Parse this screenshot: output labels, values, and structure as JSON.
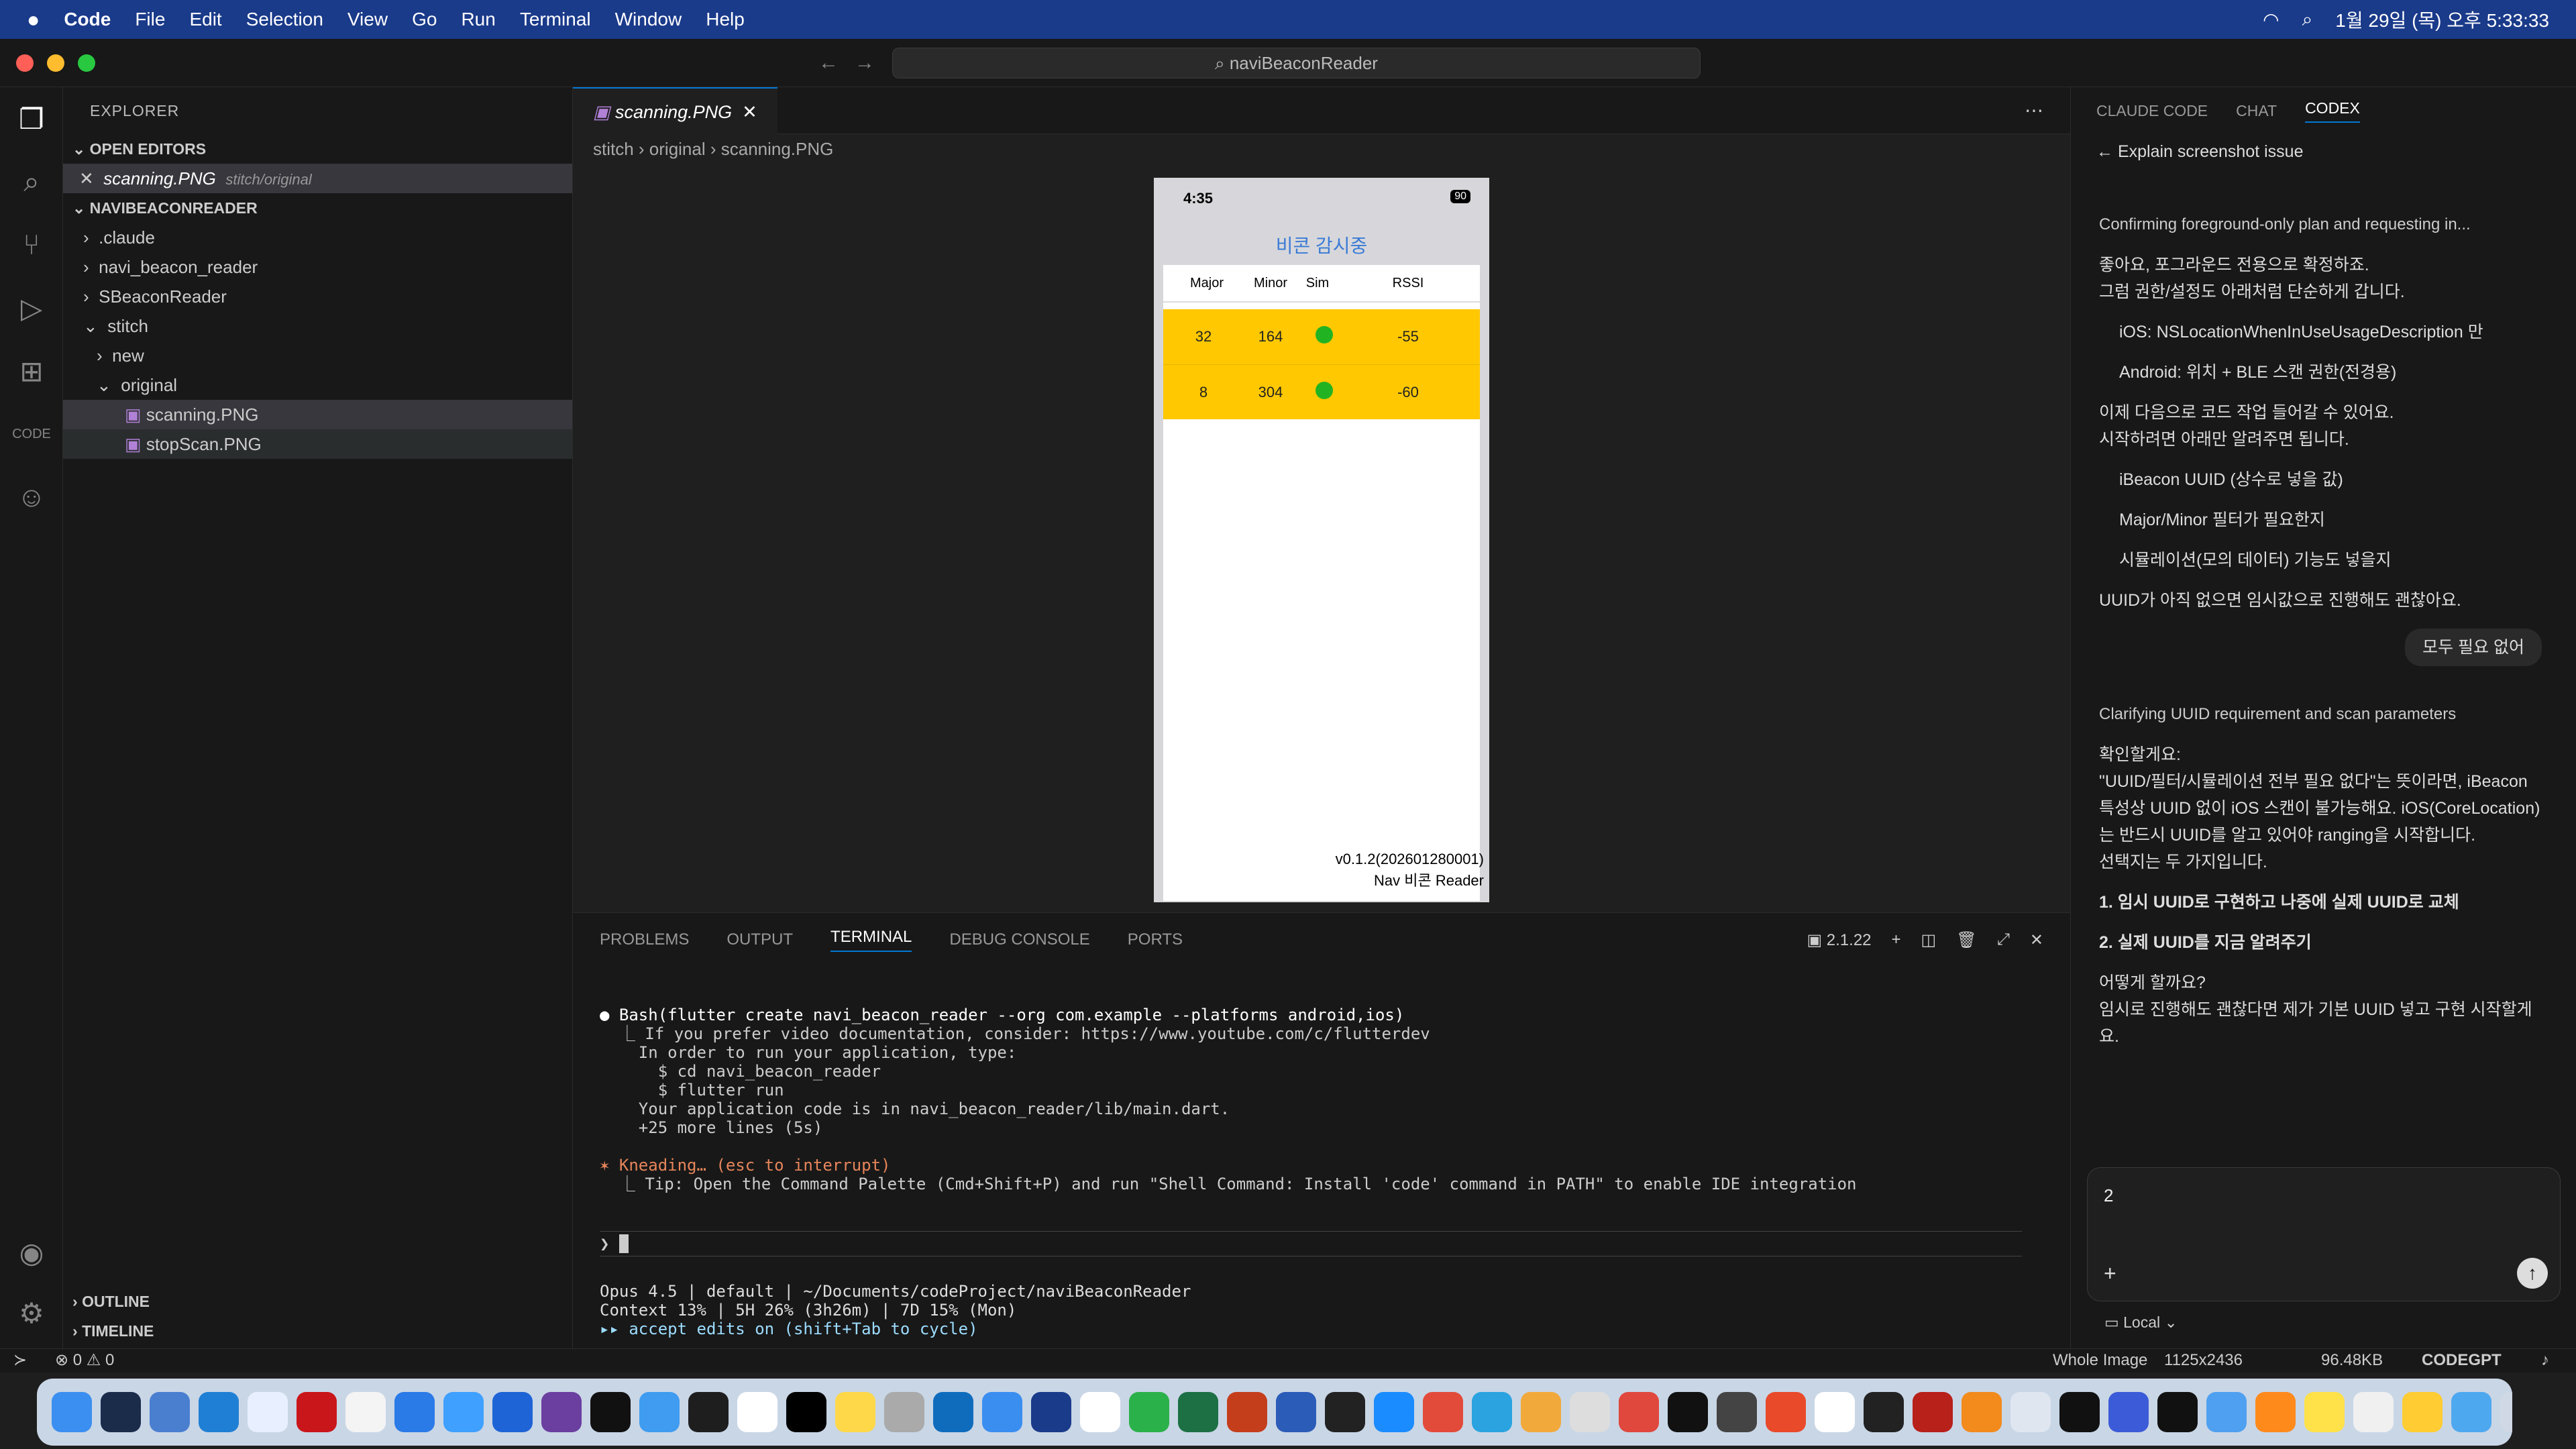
{
  "menubar": {
    "app": "Code",
    "items": [
      "File",
      "Edit",
      "Selection",
      "View",
      "Go",
      "Run",
      "Terminal",
      "Window",
      "Help"
    ],
    "clock": "1월 29일 (목) 오후 5:33:33"
  },
  "window": {
    "search": "naviBeaconReader"
  },
  "explorer": {
    "title": "EXPLORER",
    "open_editors": "OPEN EDITORS",
    "open_file": "scanning.PNG",
    "open_path": "stitch/original",
    "project": "NAVIBEACONREADER",
    "tree": [
      ".claude",
      "navi_beacon_reader",
      "SBeaconReader",
      "stitch",
      "new",
      "original",
      "scanning.PNG",
      "stopScan.PNG"
    ],
    "outline": "OUTLINE",
    "timeline": "TIMELINE"
  },
  "editor": {
    "tab": "scanning.PNG",
    "crumbs": [
      "stitch",
      "original",
      "scanning.PNG"
    ]
  },
  "phone": {
    "time": "4:35",
    "battery": "90",
    "title": "비콘 감시중",
    "headers": [
      "Major",
      "Minor",
      "Sim",
      "RSSI"
    ],
    "rows": [
      [
        "32",
        "164",
        "-55"
      ],
      [
        "8",
        "304",
        "-60"
      ]
    ],
    "version": "v0.1.2(202601280001)",
    "app_name": "Nav 비콘 Reader"
  },
  "panel": {
    "tabs": [
      "PROBLEMS",
      "OUTPUT",
      "TERMINAL",
      "DEBUG CONSOLE",
      "PORTS"
    ],
    "active_tab": "TERMINAL",
    "shell_version": "2.1.22",
    "lines": [
      "● Bash(flutter create navi_beacon_reader --org com.example --platforms android,ios)",
      "  ⎿ If you prefer video documentation, consider: https://www.youtube.com/c/flutterdev",
      "    In order to run your application, type:",
      "      $ cd navi_beacon_reader",
      "      $ flutter run",
      "    Your application code is in navi_beacon_reader/lib/main.dart.",
      "    +25 more lines (5s)",
      "",
      "✶ Kneading… (esc to interrupt)",
      "  ⎿ Tip: Open the Command Palette (Cmd+Shift+P) and run \"Shell Command: Install 'code' command in PATH\" to enable IDE integration"
    ],
    "prompt": "❯",
    "status1": "Opus 4.5 | default | ~/Documents/codeProject/naviBeaconReader",
    "status2": "Context 13% | 5H 26% (3h26m) | 7D 15% (Mon)",
    "status3": "▸▸ accept edits on (shift+Tab to cycle)"
  },
  "codex": {
    "tabs": [
      "CLAUDE CODE",
      "CHAT",
      "CODEX"
    ],
    "thread_title": "Explain screenshot issue",
    "heading1": "Confirming foreground-only plan and requesting in...",
    "p1": "좋아요, 포그라운드 전용으로 확정하죠.",
    "p2": "그럼 권한/설정도 아래처럼 단순하게 갑니다.",
    "b1": "iOS: NSLocationWhenInUseUsageDescription 만",
    "b2": "Android: 위치 + BLE 스캔 권한(전경용)",
    "p3": "이제 다음으로 코드 작업 들어갈 수 있어요.",
    "p4": "시작하려면 아래만 알려주면 됩니다.",
    "b3": "iBeacon UUID (상수로 넣을 값)",
    "b4": "Major/Minor 필터가 필요한지",
    "b5": "시뮬레이션(모의 데이터) 기능도 넣을지",
    "p5": "UUID가 아직 없으면 임시값으로 진행해도 괜찮아요.",
    "user_msg": "모두 필요 없어",
    "heading2": "Clarifying UUID requirement and scan parameters",
    "p6": "확인할게요:",
    "p7": "\"UUID/필터/시뮬레이션 전부 필요 없다\"는 뜻이라면, iBeacon 특성상 UUID 없이 iOS 스캔이 불가능해요. iOS(CoreLocation)는 반드시 UUID를 알고 있어야 ranging을 시작합니다.",
    "p8": "선택지는 두 가지입니다.",
    "o1": "1. 임시 UUID로 구현하고 나중에 실제 UUID로 교체",
    "o2": "2. 실제 UUID를 지금 알려주기",
    "p9": "어떻게 할까요?",
    "p10": "임시로 진행해도 괜찮다면 제가 기본 UUID 넣고 구현 시작할게요.",
    "input": "2",
    "local": "Local"
  },
  "statusbar": {
    "problems": "⊗ 0 ⚠ 0",
    "right1": "Whole Image",
    "right2": "1125x2436",
    "right3": "96.48KB",
    "right4": "CODEGPT"
  },
  "colors": {
    "accent": "#0078d4",
    "row_yellow": "#ffc800",
    "title_blue": "#3a7bd5",
    "menubar": "#1a3a8a"
  }
}
